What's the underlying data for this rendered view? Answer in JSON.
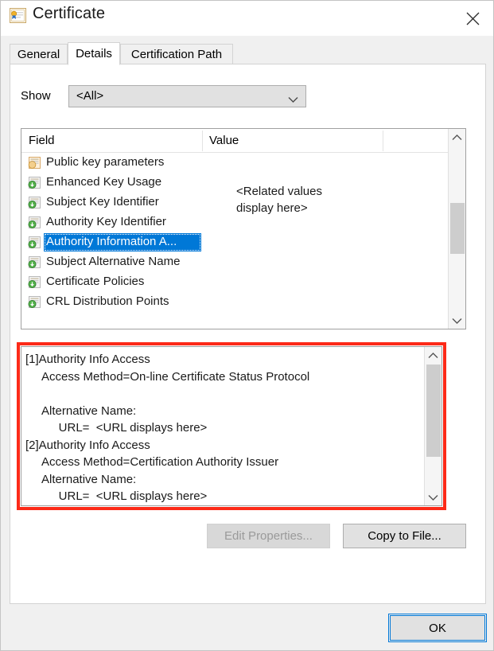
{
  "window": {
    "title": "Certificate",
    "icon": "certificate-icon",
    "close_label": "✕"
  },
  "tabs": [
    {
      "label": "General",
      "active": false
    },
    {
      "label": "Details",
      "active": true
    },
    {
      "label": "Certification Path",
      "active": false
    }
  ],
  "show": {
    "label": "Show",
    "selected": "<All>",
    "options": [
      "<All>"
    ]
  },
  "field_list": {
    "columns": [
      "Field",
      "Value"
    ],
    "rows": [
      {
        "label": "Public key parameters",
        "icon": "certificate-field-icon",
        "icon_style": "tan",
        "selected": false
      },
      {
        "label": "Enhanced Key Usage",
        "icon": "certificate-extension-icon",
        "icon_style": "green",
        "selected": false
      },
      {
        "label": "Subject Key Identifier",
        "icon": "certificate-extension-icon",
        "icon_style": "green",
        "selected": false
      },
      {
        "label": "Authority Key Identifier",
        "icon": "certificate-extension-icon",
        "icon_style": "green",
        "selected": false
      },
      {
        "label": "Authority Information A...",
        "icon": "certificate-extension-icon",
        "icon_style": "green",
        "selected": true
      },
      {
        "label": "Subject Alternative Name",
        "icon": "certificate-extension-icon",
        "icon_style": "green",
        "selected": false
      },
      {
        "label": "Certificate Policies",
        "icon": "certificate-extension-icon",
        "icon_style": "green",
        "selected": false
      },
      {
        "label": "CRL Distribution Points",
        "icon": "certificate-extension-icon",
        "icon_style": "green",
        "selected": false
      }
    ],
    "value_text": "<Related values\ndisplay here>"
  },
  "detail": {
    "text": "[1]Authority Info Access\n     Access Method=On-line Certificate Status Protocol\n\n     Alternative Name:\n          URL=  <URL displays here>\n[2]Authority Info Access\n     Access Method=Certification Authority Issuer\n     Alternative Name:\n          URL=  <URL displays here>"
  },
  "buttons": {
    "edit_properties": "Edit Properties...",
    "copy_to_file": "Copy to File...",
    "ok": "OK"
  },
  "colors": {
    "selection_blue": "#0078d7",
    "annotation_red": "#fc2a18",
    "dialog_bg": "#f0f0f0",
    "control_bg": "#e1e1e1"
  }
}
